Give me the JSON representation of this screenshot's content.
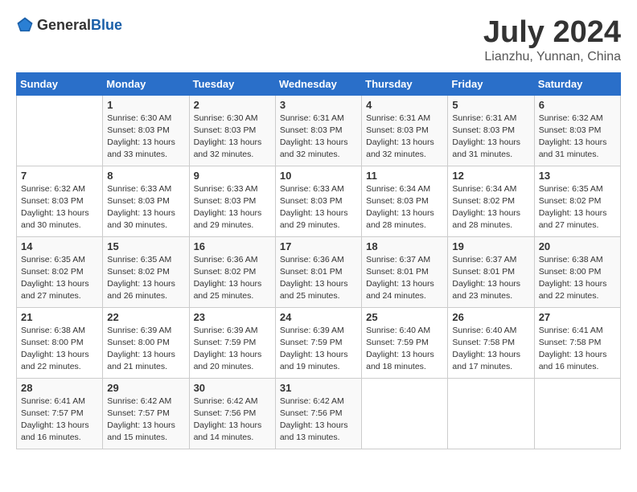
{
  "header": {
    "logo_general": "General",
    "logo_blue": "Blue",
    "month_year": "July 2024",
    "location": "Lianzhu, Yunnan, China"
  },
  "weekdays": [
    "Sunday",
    "Monday",
    "Tuesday",
    "Wednesday",
    "Thursday",
    "Friday",
    "Saturday"
  ],
  "weeks": [
    [
      {
        "day": "",
        "sunrise": "",
        "sunset": "",
        "daylight": ""
      },
      {
        "day": "1",
        "sunrise": "Sunrise: 6:30 AM",
        "sunset": "Sunset: 8:03 PM",
        "daylight": "Daylight: 13 hours and 33 minutes."
      },
      {
        "day": "2",
        "sunrise": "Sunrise: 6:30 AM",
        "sunset": "Sunset: 8:03 PM",
        "daylight": "Daylight: 13 hours and 32 minutes."
      },
      {
        "day": "3",
        "sunrise": "Sunrise: 6:31 AM",
        "sunset": "Sunset: 8:03 PM",
        "daylight": "Daylight: 13 hours and 32 minutes."
      },
      {
        "day": "4",
        "sunrise": "Sunrise: 6:31 AM",
        "sunset": "Sunset: 8:03 PM",
        "daylight": "Daylight: 13 hours and 32 minutes."
      },
      {
        "day": "5",
        "sunrise": "Sunrise: 6:31 AM",
        "sunset": "Sunset: 8:03 PM",
        "daylight": "Daylight: 13 hours and 31 minutes."
      },
      {
        "day": "6",
        "sunrise": "Sunrise: 6:32 AM",
        "sunset": "Sunset: 8:03 PM",
        "daylight": "Daylight: 13 hours and 31 minutes."
      }
    ],
    [
      {
        "day": "7",
        "sunrise": "Sunrise: 6:32 AM",
        "sunset": "Sunset: 8:03 PM",
        "daylight": "Daylight: 13 hours and 30 minutes."
      },
      {
        "day": "8",
        "sunrise": "Sunrise: 6:33 AM",
        "sunset": "Sunset: 8:03 PM",
        "daylight": "Daylight: 13 hours and 30 minutes."
      },
      {
        "day": "9",
        "sunrise": "Sunrise: 6:33 AM",
        "sunset": "Sunset: 8:03 PM",
        "daylight": "Daylight: 13 hours and 29 minutes."
      },
      {
        "day": "10",
        "sunrise": "Sunrise: 6:33 AM",
        "sunset": "Sunset: 8:03 PM",
        "daylight": "Daylight: 13 hours and 29 minutes."
      },
      {
        "day": "11",
        "sunrise": "Sunrise: 6:34 AM",
        "sunset": "Sunset: 8:03 PM",
        "daylight": "Daylight: 13 hours and 28 minutes."
      },
      {
        "day": "12",
        "sunrise": "Sunrise: 6:34 AM",
        "sunset": "Sunset: 8:02 PM",
        "daylight": "Daylight: 13 hours and 28 minutes."
      },
      {
        "day": "13",
        "sunrise": "Sunrise: 6:35 AM",
        "sunset": "Sunset: 8:02 PM",
        "daylight": "Daylight: 13 hours and 27 minutes."
      }
    ],
    [
      {
        "day": "14",
        "sunrise": "Sunrise: 6:35 AM",
        "sunset": "Sunset: 8:02 PM",
        "daylight": "Daylight: 13 hours and 27 minutes."
      },
      {
        "day": "15",
        "sunrise": "Sunrise: 6:35 AM",
        "sunset": "Sunset: 8:02 PM",
        "daylight": "Daylight: 13 hours and 26 minutes."
      },
      {
        "day": "16",
        "sunrise": "Sunrise: 6:36 AM",
        "sunset": "Sunset: 8:02 PM",
        "daylight": "Daylight: 13 hours and 25 minutes."
      },
      {
        "day": "17",
        "sunrise": "Sunrise: 6:36 AM",
        "sunset": "Sunset: 8:01 PM",
        "daylight": "Daylight: 13 hours and 25 minutes."
      },
      {
        "day": "18",
        "sunrise": "Sunrise: 6:37 AM",
        "sunset": "Sunset: 8:01 PM",
        "daylight": "Daylight: 13 hours and 24 minutes."
      },
      {
        "day": "19",
        "sunrise": "Sunrise: 6:37 AM",
        "sunset": "Sunset: 8:01 PM",
        "daylight": "Daylight: 13 hours and 23 minutes."
      },
      {
        "day": "20",
        "sunrise": "Sunrise: 6:38 AM",
        "sunset": "Sunset: 8:00 PM",
        "daylight": "Daylight: 13 hours and 22 minutes."
      }
    ],
    [
      {
        "day": "21",
        "sunrise": "Sunrise: 6:38 AM",
        "sunset": "Sunset: 8:00 PM",
        "daylight": "Daylight: 13 hours and 22 minutes."
      },
      {
        "day": "22",
        "sunrise": "Sunrise: 6:39 AM",
        "sunset": "Sunset: 8:00 PM",
        "daylight": "Daylight: 13 hours and 21 minutes."
      },
      {
        "day": "23",
        "sunrise": "Sunrise: 6:39 AM",
        "sunset": "Sunset: 7:59 PM",
        "daylight": "Daylight: 13 hours and 20 minutes."
      },
      {
        "day": "24",
        "sunrise": "Sunrise: 6:39 AM",
        "sunset": "Sunset: 7:59 PM",
        "daylight": "Daylight: 13 hours and 19 minutes."
      },
      {
        "day": "25",
        "sunrise": "Sunrise: 6:40 AM",
        "sunset": "Sunset: 7:59 PM",
        "daylight": "Daylight: 13 hours and 18 minutes."
      },
      {
        "day": "26",
        "sunrise": "Sunrise: 6:40 AM",
        "sunset": "Sunset: 7:58 PM",
        "daylight": "Daylight: 13 hours and 17 minutes."
      },
      {
        "day": "27",
        "sunrise": "Sunrise: 6:41 AM",
        "sunset": "Sunset: 7:58 PM",
        "daylight": "Daylight: 13 hours and 16 minutes."
      }
    ],
    [
      {
        "day": "28",
        "sunrise": "Sunrise: 6:41 AM",
        "sunset": "Sunset: 7:57 PM",
        "daylight": "Daylight: 13 hours and 16 minutes."
      },
      {
        "day": "29",
        "sunrise": "Sunrise: 6:42 AM",
        "sunset": "Sunset: 7:57 PM",
        "daylight": "Daylight: 13 hours and 15 minutes."
      },
      {
        "day": "30",
        "sunrise": "Sunrise: 6:42 AM",
        "sunset": "Sunset: 7:56 PM",
        "daylight": "Daylight: 13 hours and 14 minutes."
      },
      {
        "day": "31",
        "sunrise": "Sunrise: 6:42 AM",
        "sunset": "Sunset: 7:56 PM",
        "daylight": "Daylight: 13 hours and 13 minutes."
      },
      {
        "day": "",
        "sunrise": "",
        "sunset": "",
        "daylight": ""
      },
      {
        "day": "",
        "sunrise": "",
        "sunset": "",
        "daylight": ""
      },
      {
        "day": "",
        "sunrise": "",
        "sunset": "",
        "daylight": ""
      }
    ]
  ]
}
